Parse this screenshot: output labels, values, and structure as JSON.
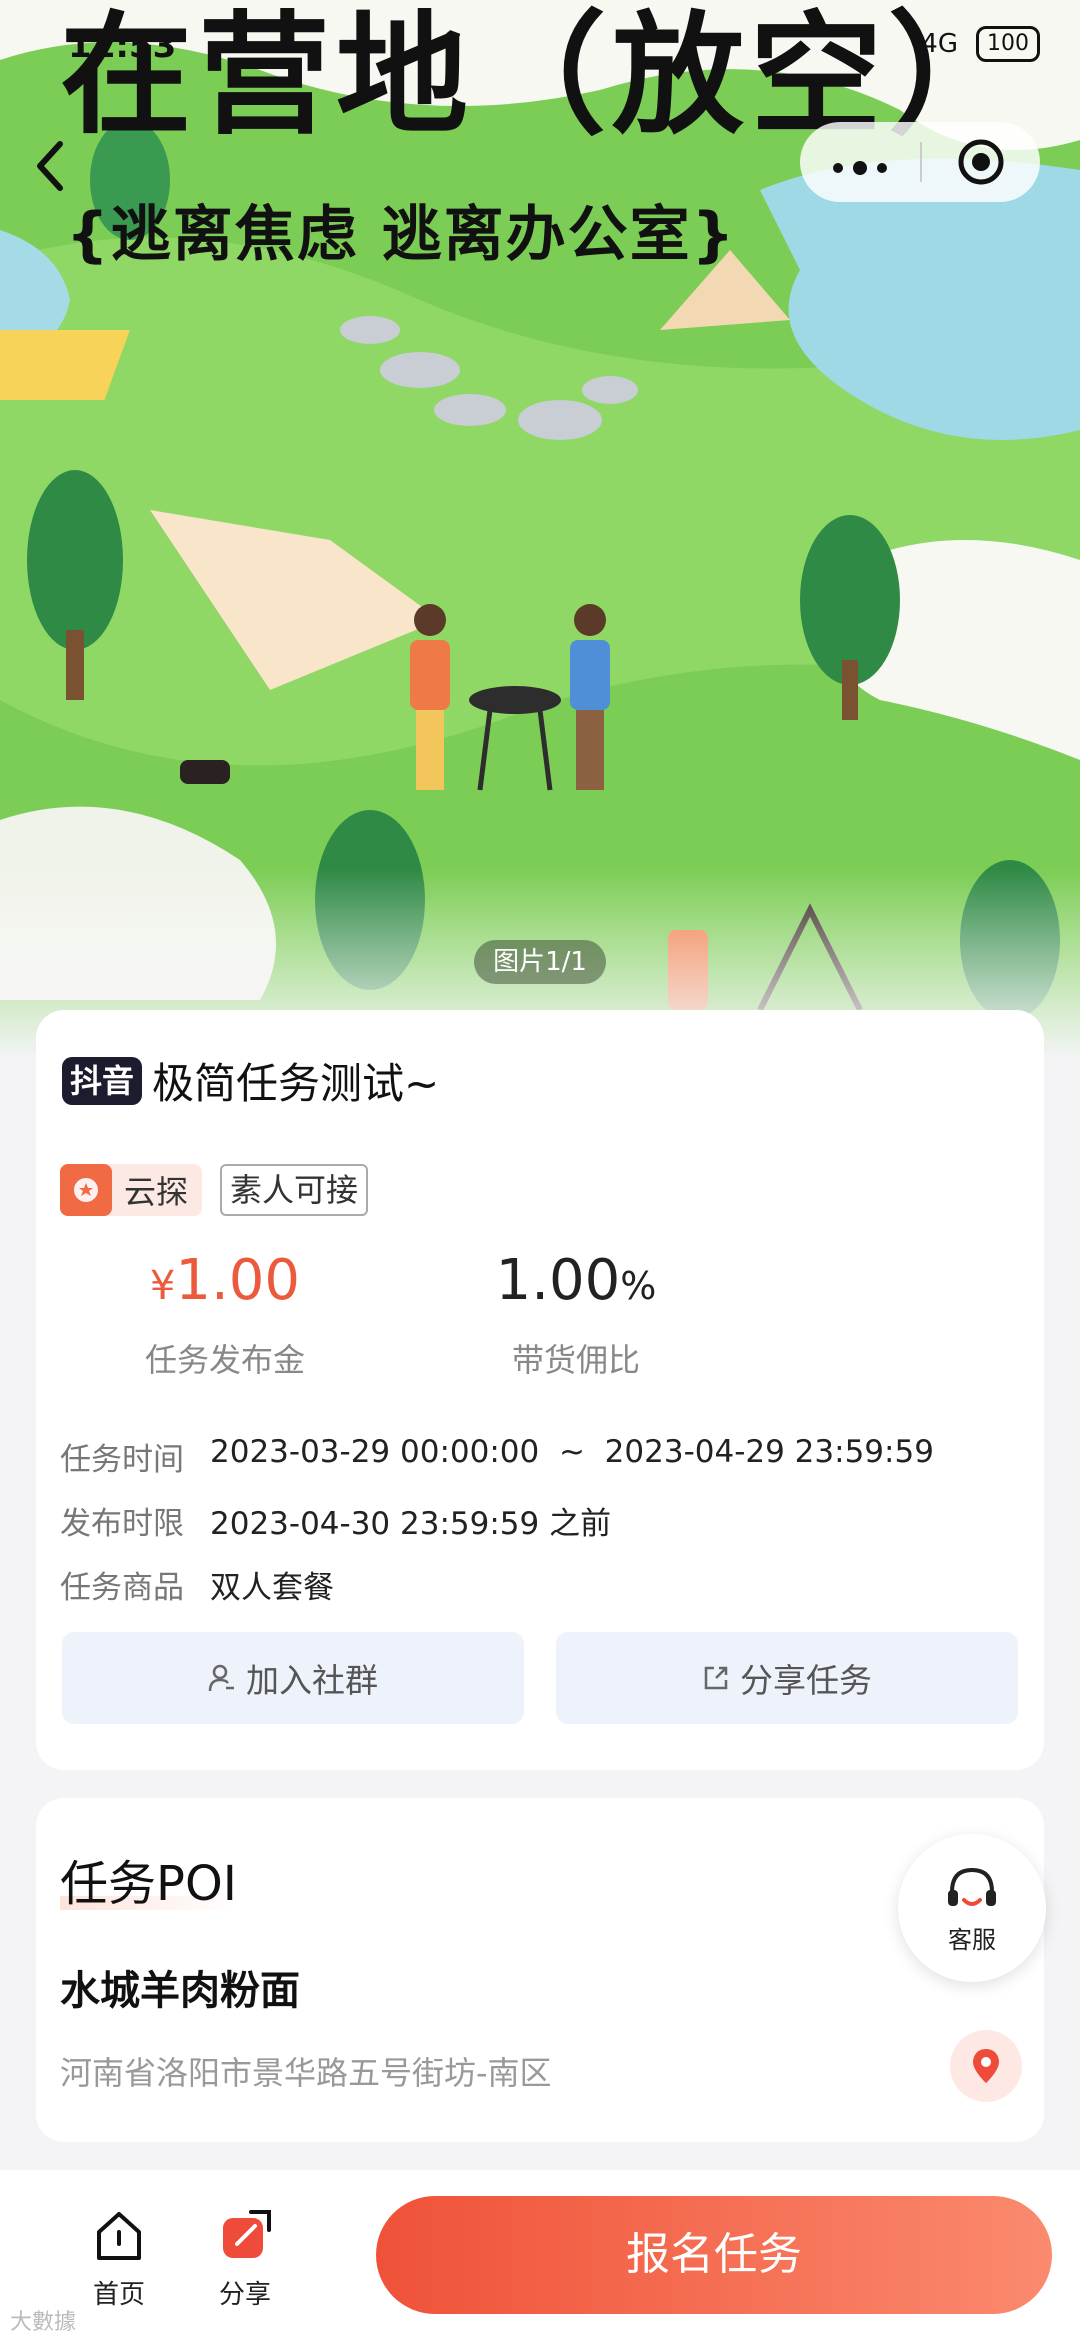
{
  "status_bar": {
    "time": "11:53",
    "battery": "100",
    "network": "4G"
  },
  "hero": {
    "title": "在营地（放空）",
    "subtitle": "{逃离焦虑 逃离办公室}",
    "image_counter": "图片1/1"
  },
  "nav": {
    "back_icon": "chevron-left-icon",
    "more_icon": "more-dots-icon",
    "close_icon": "target-close-icon"
  },
  "task": {
    "platform_badge": "抖音",
    "title": "极简任务测试~",
    "tags": {
      "cloud": "云探",
      "amateur": "素人可接"
    },
    "price_symbol": "¥",
    "price": "1.00",
    "price_label": "任务发布金",
    "commission": "1.00",
    "commission_unit": "%",
    "commission_label": "带货佣比",
    "time_label": "任务时间",
    "time_start": "2023-03-29 00:00:00",
    "time_sep": "~",
    "time_end": "2023-04-29 23:59:59",
    "deadline_label": "发布时限",
    "deadline_value": "2023-04-30 23:59:59 之前",
    "product_label": "任务商品",
    "product_value": "双人套餐",
    "join_group": "加入社群",
    "share_task": "分享任务"
  },
  "poi": {
    "title": "任务POI",
    "name": "水城羊肉粉面",
    "address": "河南省洛阳市景华路五号街坊-南区"
  },
  "service": {
    "label": "客服"
  },
  "bottom": {
    "home": "首页",
    "share": "分享",
    "signup": "报名任务"
  },
  "watermark": "大數據"
}
